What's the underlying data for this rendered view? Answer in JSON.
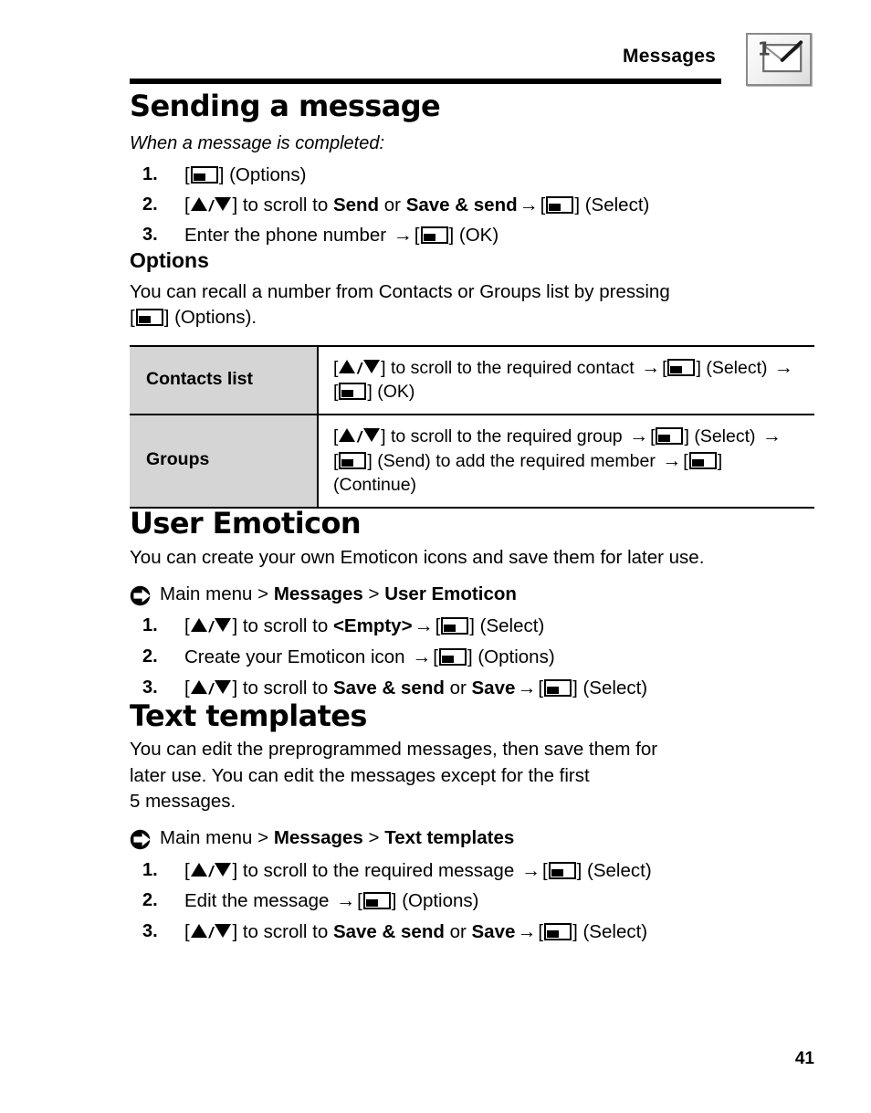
{
  "header": {
    "title": "Messages",
    "icon_name": "envelope-with-1-badge-icon"
  },
  "sections": {
    "sending": {
      "title": "Sending a message",
      "intro_italic": "When a message is completed:",
      "steps": [
        {
          "num": "1.",
          "parts": [
            "[",
            "softkey",
            "] (Options)"
          ]
        },
        {
          "num": "2.",
          "parts": [
            "[",
            "updown",
            "] to scroll to ",
            "b:Send",
            " or ",
            "b:Save & send",
            " ",
            "arrow",
            " [",
            "softkey",
            "] (Select)"
          ]
        },
        {
          "num": "3.",
          "parts": [
            "Enter the phone number ",
            "arrow",
            " [",
            "softkey",
            "] (OK)"
          ]
        }
      ]
    },
    "options": {
      "title": "Options",
      "body_prefix": "You can recall a number from Contacts or Groups list by pressing",
      "body_suffix": "] (Options).",
      "table": {
        "rows": [
          {
            "label": "Contacts list",
            "desc_1": "] to scroll to the required contact ",
            "desc_2": "] (Select) ",
            "desc_3": "] (OK)"
          },
          {
            "label": "Groups",
            "desc_1": "] to scroll to the required group ",
            "desc_2": "] (Select) ",
            "desc_3": "] (Send) to add the required member ",
            "desc_4": "]",
            "desc_5": "(Continue)"
          }
        ]
      }
    },
    "user_emoticon": {
      "title": "User Emoticon",
      "body": "You can create your own Emoticon icons and save them for later use.",
      "path": {
        "icon_name": "arrow-circle-right-icon",
        "root": "Main menu",
        "sep": ">",
        "crumb1": "Messages",
        "crumb2": "User Emoticon"
      },
      "steps": {
        "s1_a": "] to scroll to ",
        "s1_b": "<Empty>",
        "s1_c": "] (Select)",
        "s2_a": "Create your Emoticon icon ",
        "s2_b": "] (Options)",
        "s3_a": "] to scroll to ",
        "s3_b": "Save & send",
        "s3_or": " or ",
        "s3_c": "Save",
        "s3_d": "] (Select)"
      }
    },
    "text_templates": {
      "title": "Text templates",
      "body_line1": "You can edit the preprogrammed messages, then save them for",
      "body_line2": "later use. You can edit the messages except for the first",
      "body_line3": "5 messages.",
      "path": {
        "icon_name": "arrow-circle-right-icon",
        "root": "Main menu",
        "sep": ">",
        "crumb1": "Messages",
        "crumb2": "Text templates"
      },
      "steps": {
        "s1_a": "] to scroll to the required message ",
        "s1_b": "] (Select)",
        "s2_a": "Edit the message ",
        "s2_b": "] (Options)",
        "s3_a": "] to scroll to ",
        "s3_b": "Save & send",
        "s3_or": " or ",
        "s3_c": "Save",
        "s3_d": "] (Select)"
      }
    }
  },
  "footer": {
    "page_number": "41"
  },
  "step_numbers": {
    "one": "1.",
    "two": "2.",
    "three": "3."
  },
  "glyphs": {
    "bracket_open": "[",
    "arrow_right": "→",
    "slash": "/"
  },
  "colors": {
    "ink": "#000000",
    "table_label_bg": "#d5d5d5",
    "page_bg": "#ffffff"
  }
}
